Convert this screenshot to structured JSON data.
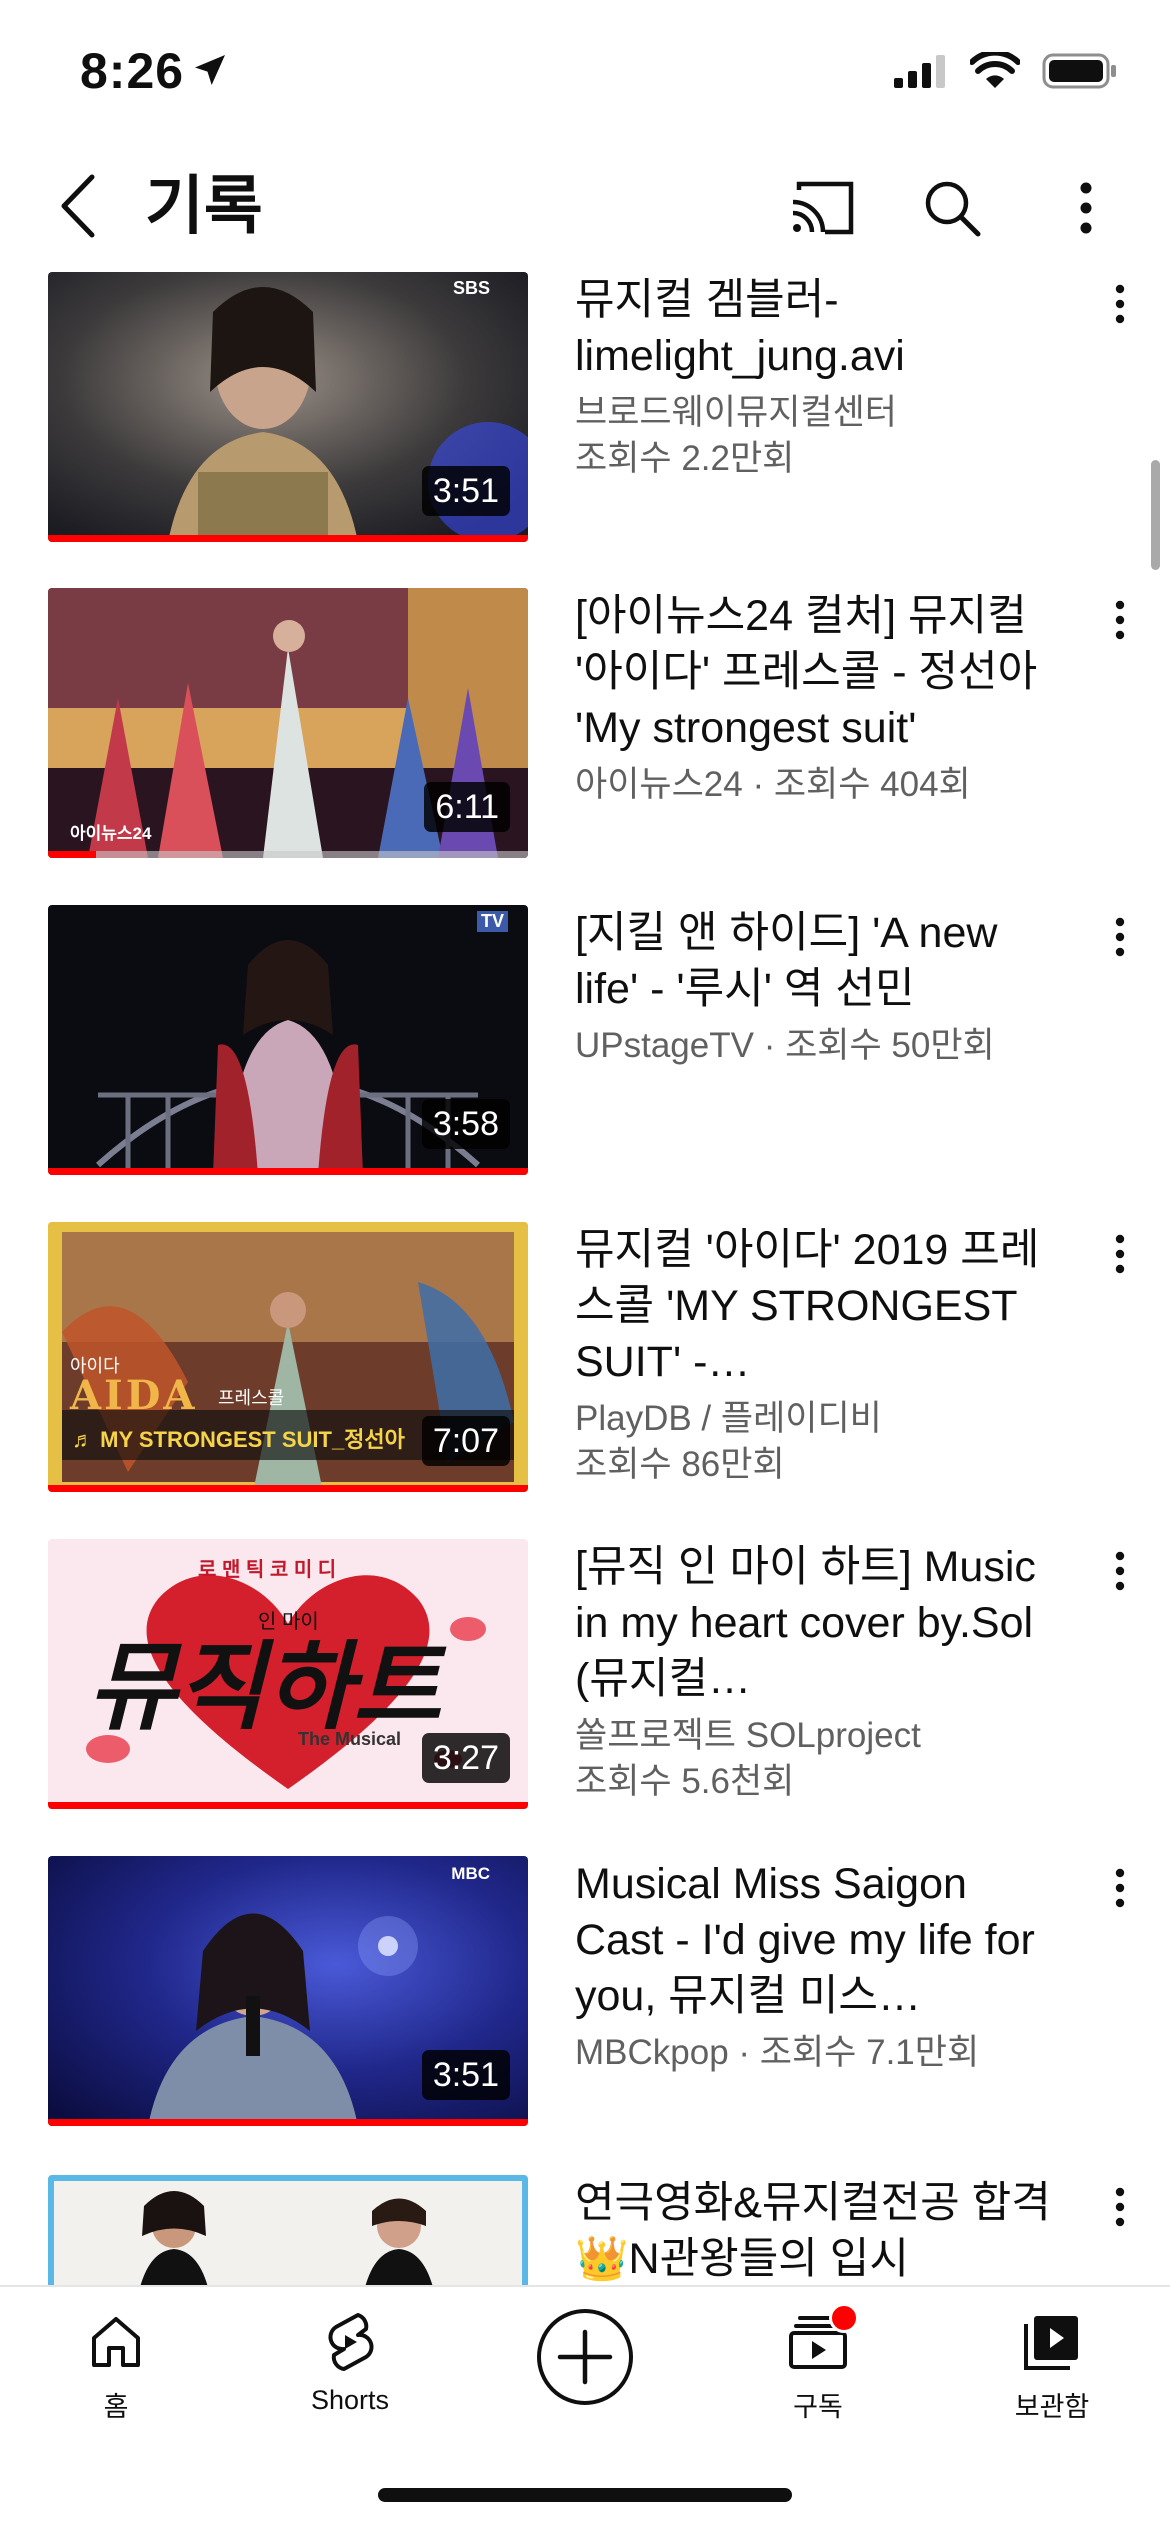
{
  "status_bar": {
    "time": "8:26"
  },
  "header": {
    "title": "기록"
  },
  "videos": [
    {
      "title": "뮤지컬 겜블러-limelight_jung.avi",
      "sub1": "브로드웨이뮤지컬센터",
      "sub2": "조회수 2.2만회",
      "duration": "3:51",
      "watched_fraction": 1.0,
      "thumb_watermark": "SBS"
    },
    {
      "title": "[아이뉴스24 컬처] 뮤지컬 '아이다' 프레스콜 - 정선아 'My strongest suit'",
      "sub1": "아이뉴스24 · 조회수 404회",
      "sub2": "",
      "duration": "6:11",
      "watched_fraction": 0.1,
      "thumb_watermark": "아이뉴스24"
    },
    {
      "title": "[지킬 앤 하이드] 'A new life' - '루시' 역 선민",
      "sub1": "UPstageTV · 조회수 50만회",
      "sub2": "",
      "duration": "3:58",
      "watched_fraction": 1.0,
      "thumb_watermark": "TV"
    },
    {
      "title": "뮤지컬 '아이다' 2019 프레스콜 'MY STRONGEST SUIT' -…",
      "sub1": "PlayDB / 플레이디비",
      "sub2": "조회수 86만회",
      "duration": "7:07",
      "watched_fraction": 1.0,
      "thumb_caption": "♬ MY STRONGEST SUIT_정선아",
      "thumb_logo": "AIDA",
      "thumb_logo_small": "아이다",
      "thumb_tag": "프레스콜"
    },
    {
      "title": "[뮤직 인 마이 하트] Music in my heart cover by.Sol (뮤지컬…",
      "sub1": "쏠프로젝트 SOLproject",
      "sub2": "조회수 5.6천회",
      "duration": "3:27",
      "watched_fraction": 1.0,
      "thumb_top": "로 맨 틱 코 미 디",
      "thumb_logo": "뮤직하트",
      "thumb_small": "인 마이",
      "thumb_tag": "The Musical"
    },
    {
      "title": "Musical Miss Saigon Cast - I'd give my life for you, 뮤지컬 미스…",
      "sub1": "MBCkpop · 조회수 7.1만회",
      "sub2": "",
      "duration": "3:51",
      "watched_fraction": 1.0,
      "thumb_watermark": "MBC"
    },
    {
      "title": "연극영화&뮤지컬전공 합격 👑N관왕들의 입시",
      "sub1": "",
      "sub2": "",
      "duration": "",
      "watched_fraction": 1.0
    }
  ],
  "bottom_nav": [
    {
      "label": "홈",
      "icon": "home-icon"
    },
    {
      "label": "Shorts",
      "icon": "shorts-icon"
    },
    {
      "label": "",
      "icon": "create-plus-icon"
    },
    {
      "label": "구독",
      "icon": "subscriptions-icon",
      "badge": true
    },
    {
      "label": "보관함",
      "icon": "library-icon"
    }
  ],
  "colors": {
    "accent": "#ff0000",
    "text": "#0f0f0f",
    "secondary": "#606060"
  }
}
